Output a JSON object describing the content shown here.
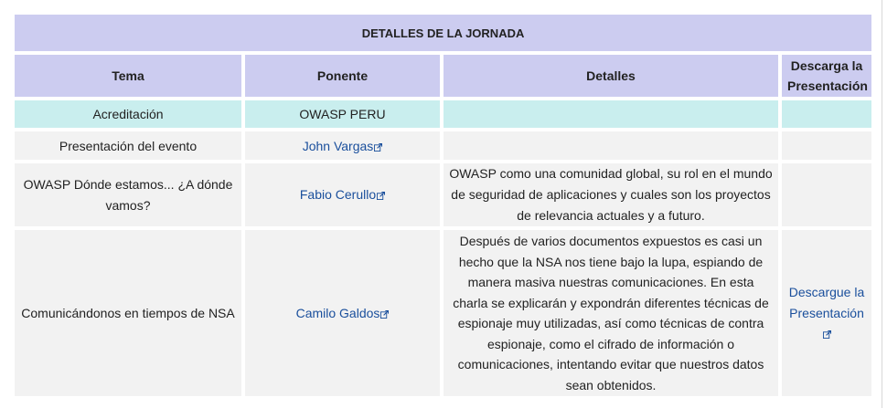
{
  "table": {
    "caption": "DETALLES DE LA JORNADA",
    "headers": {
      "topic": "Tema",
      "speaker": "Ponente",
      "details": "Detalles",
      "download": "Descarga la Presentación"
    },
    "rows": [
      {
        "topic": "Acreditación",
        "speaker": "OWASP PERU",
        "details": "",
        "download": ""
      },
      {
        "topic": "Presentación del evento",
        "speaker": "John Vargas",
        "details": "",
        "download": ""
      },
      {
        "topic": "OWASP Dónde estamos... ¿A dónde vamos?",
        "speaker": "Fabio Cerullo",
        "details": "OWASP como una comunidad global, su rol en el mundo de seguridad de aplicaciones y cuales son los proyectos de relevancia actuales y a futuro.",
        "download": ""
      },
      {
        "topic": "Comunicándonos en tiempos de NSA",
        "speaker": "Camilo Galdos",
        "details": "Después de varios documentos expuestos es casi un hecho que la NSA nos tiene bajo la lupa, espiando de manera masiva nuestras comunicaciones. En esta charla se explicarán y expondrán diferentes técnicas de espionaje muy utilizadas, así como técnicas de contra espionaje, como el cifrado de información o comunicaciones, intentando evitar que nuestros datos sean obtenidos.",
        "download": "Descargue la Presentación"
      }
    ]
  },
  "colors": {
    "header_bg": "#ccccf0",
    "accreditation_bg": "#c9eeee",
    "row_bg": "#f2f2f2",
    "link": "#1a4f9c"
  },
  "icons": {
    "external_link": "external-link-icon"
  }
}
